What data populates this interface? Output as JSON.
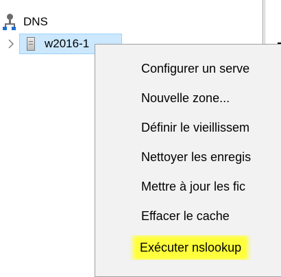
{
  "tree": {
    "root": {
      "label": "DNS",
      "icon": "dns-icon"
    },
    "child": {
      "label": "w2016-1",
      "icon": "server-icon",
      "expand_icon": "chevron-right-icon",
      "selected": true
    }
  },
  "context_menu": {
    "items": [
      {
        "label": "Configurer un serve"
      },
      {
        "label": "Nouvelle zone..."
      },
      {
        "label": "Définir le vieillissem"
      },
      {
        "label": "Nettoyer les enregis"
      },
      {
        "label": "Mettre à jour les fic"
      },
      {
        "label": "Effacer le cache"
      },
      {
        "label": "Exécuter nslookup",
        "highlighted": true
      }
    ]
  },
  "colors": {
    "selection_bg": "#cce8ff",
    "selection_border": "#99d1ff",
    "menu_bg": "#f2f2f2",
    "highlight": "#ffff3b"
  }
}
